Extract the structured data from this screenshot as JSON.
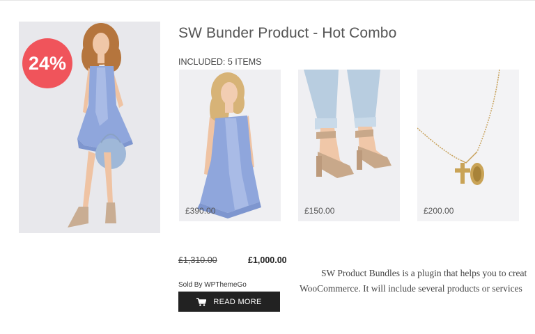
{
  "product": {
    "title": "SW Bunder Product - Hot Combo",
    "sale_badge": "24%",
    "included_label": "INCLUDED: 5 ITEMS",
    "items": [
      {
        "name": "blue ruffle dress",
        "price": "£390.00"
      },
      {
        "name": "suede block heel sandals",
        "price": "£150.00"
      },
      {
        "name": "gold pendant necklace",
        "price": "£200.00"
      }
    ],
    "price_old": "£1,310.00",
    "price_new": "£1,000.00",
    "sold_by": "Sold By WPThemeGo",
    "read_more_label": "READ MORE",
    "description_line1": "SW Product Bundles is a plugin that helps you to creat",
    "description_line2": "WooCommerce.  It will include several products or services"
  },
  "colors": {
    "badge": "#f0545b",
    "button": "#222222",
    "dress": "#8fa6dc"
  },
  "icons": {
    "cart": "cart-icon"
  }
}
